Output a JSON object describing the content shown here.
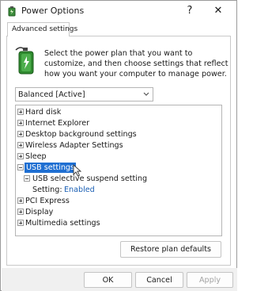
{
  "window": {
    "title": "Power Options",
    "help_glyph": "?",
    "close_glyph": "✕"
  },
  "tabs": [
    {
      "label": "Advanced settings"
    }
  ],
  "description": "Select the power plan that you want to customize, and then choose settings that reflect how you want your computer to manage power.",
  "plan": {
    "selected": "Balanced [Active]"
  },
  "tree": {
    "items": [
      {
        "label": "Hard disk",
        "expander": "plus"
      },
      {
        "label": "Internet Explorer",
        "expander": "plus"
      },
      {
        "label": "Desktop background settings",
        "expander": "plus"
      },
      {
        "label": "Wireless Adapter Settings",
        "expander": "plus"
      },
      {
        "label": "Sleep",
        "expander": "plus"
      },
      {
        "label": "USB settings",
        "expander": "minus",
        "selected": true
      },
      {
        "label": "USB selective suspend setting",
        "expander": "minus"
      },
      {
        "label": "Setting:",
        "value": "Enabled"
      },
      {
        "label": "PCI Express",
        "expander": "plus"
      },
      {
        "label": "Display",
        "expander": "plus"
      },
      {
        "label": "Multimedia settings",
        "expander": "plus"
      }
    ]
  },
  "buttons": {
    "restore": "Restore plan defaults",
    "ok": "OK",
    "cancel": "Cancel",
    "apply": "Apply"
  },
  "colors": {
    "selection": "#1f6fd2",
    "setting_value": "#1a5fb4",
    "disabled_text": "#a3a3a3"
  }
}
